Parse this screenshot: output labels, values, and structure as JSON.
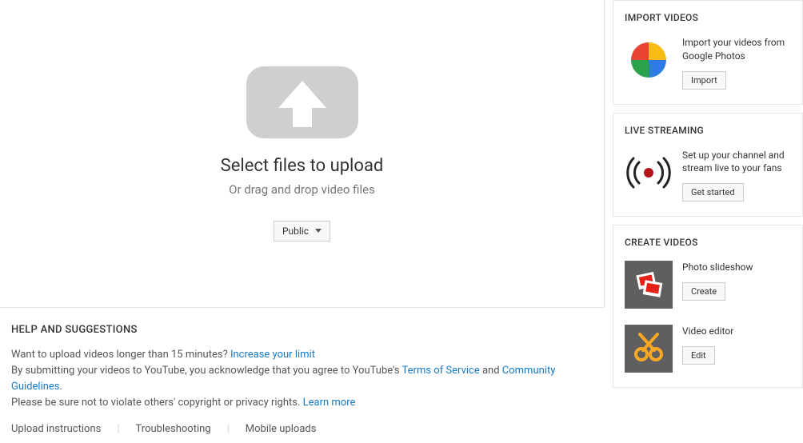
{
  "upload": {
    "title": "Select files to upload",
    "sub": "Or drag and drop video files",
    "privacy_label": "Public"
  },
  "help": {
    "title": "HELP AND SUGGESTIONS",
    "line1_pre": "Want to upload videos longer than 15 minutes? ",
    "line1_link": "Increase your limit",
    "line2_pre": "By submitting your videos to YouTube, you acknowledge that you agree to YouTube's ",
    "line2_tos": "Terms of Service",
    "line2_and": " and ",
    "line2_cg": "Community Guidelines",
    "line2_end": ".",
    "line3_pre": "Please be sure not to violate others' copyright or privacy rights. ",
    "line3_link": "Learn more",
    "links": {
      "upload_instructions": "Upload instructions",
      "troubleshooting": "Troubleshooting",
      "mobile_uploads": "Mobile uploads"
    }
  },
  "sidebar": {
    "import": {
      "title": "IMPORT VIDEOS",
      "desc": "Import your videos from Google Photos",
      "button": "Import"
    },
    "live": {
      "title": "LIVE STREAMING",
      "desc": "Set up your channel and stream live to your fans",
      "button": "Get started"
    },
    "create": {
      "title": "CREATE VIDEOS",
      "slideshow": {
        "label": "Photo slideshow",
        "button": "Create"
      },
      "editor": {
        "label": "Video editor",
        "button": "Edit"
      }
    }
  }
}
